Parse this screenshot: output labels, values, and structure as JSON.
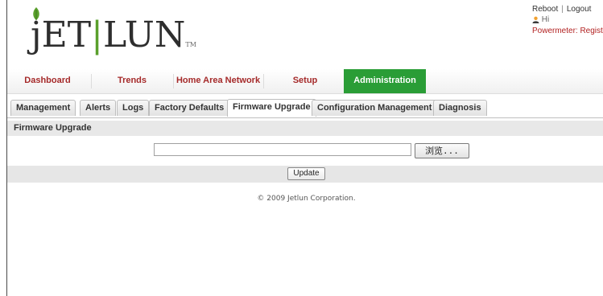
{
  "header": {
    "logo": {
      "j": "j",
      "et": "ET",
      "bar": "|",
      "lun": "LUN",
      "tm": "TM"
    },
    "links": {
      "reboot": "Reboot",
      "separator": "|",
      "logout": "Logout"
    },
    "greeting": "Hi",
    "powermeter": "Powermeter: Register"
  },
  "main_nav": [
    {
      "label": "Dashboard"
    },
    {
      "label": "Trends"
    },
    {
      "label": "Home Area Network"
    },
    {
      "label": "Setup"
    },
    {
      "label": "Administration"
    }
  ],
  "sub_tabs": [
    {
      "label": "Management"
    },
    {
      "label": "Alerts"
    },
    {
      "label": "Logs"
    },
    {
      "label": "Factory Defaults"
    },
    {
      "label": "Firmware Upgrade"
    },
    {
      "label": "Configuration Management"
    },
    {
      "label": "Diagnosis"
    }
  ],
  "panel": {
    "title": "Firmware Upgrade",
    "file_value": "",
    "browse_label": "浏览...",
    "update_label": "Update"
  },
  "footer": "© 2009 Jetlun Corporation.",
  "colors": {
    "accent_green": "#2a9d36",
    "nav_text": "#a52a2a",
    "link_red": "#b22222"
  }
}
